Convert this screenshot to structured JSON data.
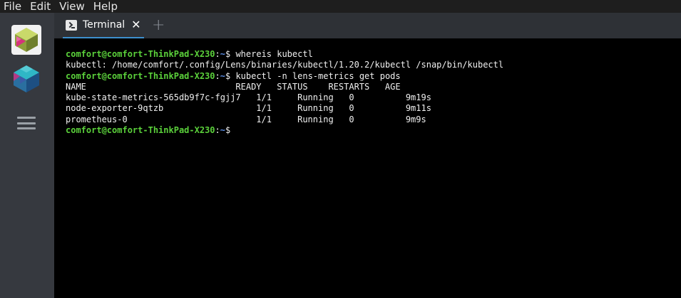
{
  "menubar": {
    "items": [
      "File",
      "Edit",
      "View",
      "Help"
    ]
  },
  "sidebar": {
    "clusters": [
      {
        "icon": "cube-cluster-icon",
        "active": true
      },
      {
        "icon": "cube-cluster-icon",
        "active": false
      }
    ],
    "menu_icon": "hamburger-menu-icon"
  },
  "tabs": {
    "items": [
      {
        "label": "Terminal",
        "icon": "terminal-icon",
        "close": "✕"
      }
    ],
    "add_label": "+",
    "accent_color": "#3d90ce"
  },
  "terminal": {
    "prompt_user": "comfort@comfort-ThinkPad-X230",
    "prompt_sep": ":",
    "prompt_path": "~",
    "prompt_end": "$ ",
    "lines": [
      {
        "type": "prompt",
        "command": "whereis kubectl"
      },
      {
        "type": "output",
        "text": "kubectl: /home/comfort/.config/Lens/binaries/kubectl/1.20.2/kubectl /snap/bin/kubectl"
      },
      {
        "type": "prompt",
        "command": "kubectl -n lens-metrics get pods"
      },
      {
        "type": "output",
        "text": "NAME                             READY   STATUS    RESTARTS   AGE"
      },
      {
        "type": "output",
        "text": "kube-state-metrics-565db9f7c-fgjj7   1/1     Running   0          9m19s"
      },
      {
        "type": "output",
        "text": "node-exporter-9qtzb                  1/1     Running   0          9m11s"
      },
      {
        "type": "output",
        "text": "prometheus-0                         1/1     Running   0          9m9s"
      },
      {
        "type": "prompt",
        "command": ""
      }
    ],
    "colors": {
      "user": "#5bd13b",
      "path": "#5c8fe6",
      "text": "#f0f0f0"
    }
  }
}
